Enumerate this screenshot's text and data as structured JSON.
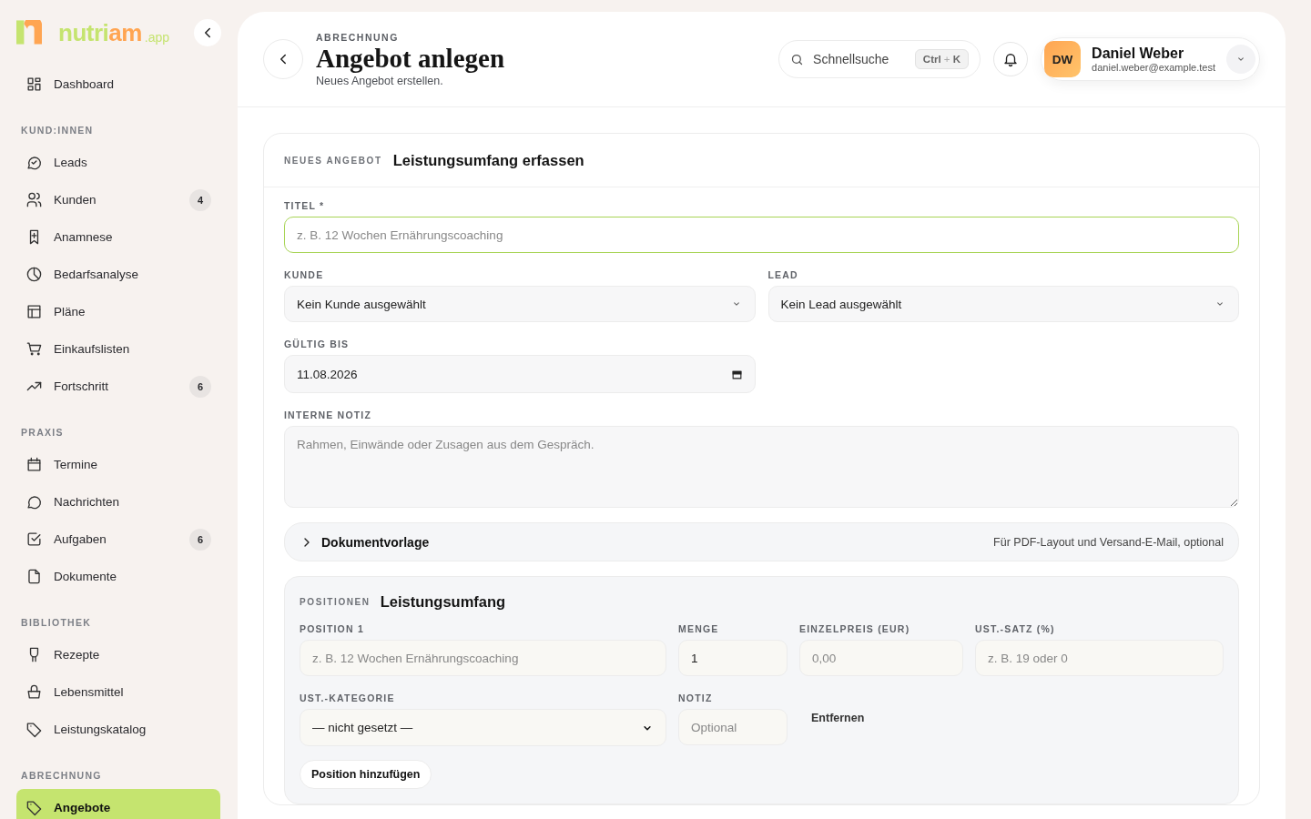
{
  "sidebar": {
    "logo": {
      "name_parts": [
        "nutri",
        "am"
      ],
      "suffix": ".app"
    },
    "groups": [
      {
        "items": [
          {
            "label": "Dashboard",
            "selected": false
          }
        ]
      },
      {
        "heading": "KUND:INNEN",
        "items": [
          {
            "label": "Leads",
            "selected": false
          },
          {
            "label": "Kunden",
            "badge": "4",
            "selected": false
          },
          {
            "label": "Anamnese",
            "selected": false
          },
          {
            "label": "Bedarfsanalyse",
            "selected": false
          },
          {
            "label": "Pläne",
            "selected": false
          },
          {
            "label": "Einkaufslisten",
            "selected": false
          },
          {
            "label": "Fortschritt",
            "badge": "6",
            "selected": false
          }
        ]
      },
      {
        "heading": "PRAXIS",
        "items": [
          {
            "label": "Termine",
            "selected": false
          },
          {
            "label": "Nachrichten",
            "selected": false
          },
          {
            "label": "Aufgaben",
            "badge": "6",
            "selected": false
          },
          {
            "label": "Dokumente",
            "selected": false
          }
        ]
      },
      {
        "heading": "BIBLIOTHEK",
        "items": [
          {
            "label": "Rezepte",
            "selected": false
          },
          {
            "label": "Lebensmittel",
            "selected": false
          },
          {
            "label": "Leistungskatalog",
            "selected": false
          }
        ]
      },
      {
        "heading": "ABRECHNUNG",
        "items": [
          {
            "label": "Angebote",
            "selected": true
          }
        ]
      }
    ]
  },
  "header": {
    "eyebrow": "ABRECHNUNG",
    "title": "Angebot anlegen",
    "subtitle": "Neues Angebot erstellen.",
    "search": {
      "placeholder": "Schnellsuche",
      "shortcut_parts": [
        "Ctrl",
        "+",
        "K"
      ]
    },
    "user": {
      "initials": "DW",
      "name": "Daniel Weber",
      "email": "daniel.weber@example.test"
    }
  },
  "form": {
    "eyebrow": "NEUES ANGEBOT",
    "title": "Leistungsumfang erfassen",
    "title_field": {
      "label": "TITEL *",
      "placeholder": "z. B. 12 Wochen Ernährungscoaching",
      "focused": true
    },
    "customer": {
      "label": "KUNDE",
      "value": "Kein Kunde ausgewählt"
    },
    "lead": {
      "label": "LEAD",
      "value": "Kein Lead ausgewählt"
    },
    "valid_until": {
      "label": "GÜLTIG BIS",
      "value": "11.08.2026"
    },
    "note": {
      "label": "INTERNE NOTIZ",
      "placeholder": "Rahmen, Einwände oder Zusagen aus dem Gespräch."
    },
    "template": {
      "title": "Dokumentvorlage",
      "hint": "Für PDF-Layout und Versand-E-Mail, optional",
      "expanded": false
    },
    "positions": {
      "eyebrow": "POSITIONEN",
      "title": "Leistungsumfang",
      "items": [
        {
          "label": "POSITION 1",
          "description_placeholder": "z. B. 12 Wochen Ernährungscoaching",
          "quantity_label": "MENGE",
          "quantity": "1",
          "price_label": "EINZELPREIS (EUR)",
          "price_placeholder": "0,00",
          "vat_label": "UST.-SATZ (%)",
          "vat_placeholder": "z. B. 19 oder 0",
          "category_label": "UST.-KATEGORIE",
          "category": "— nicht gesetzt —",
          "note_label": "NOTIZ",
          "note_placeholder": "Optional",
          "remove": "Entfernen"
        }
      ],
      "add_button": "Position hinzufügen"
    }
  }
}
